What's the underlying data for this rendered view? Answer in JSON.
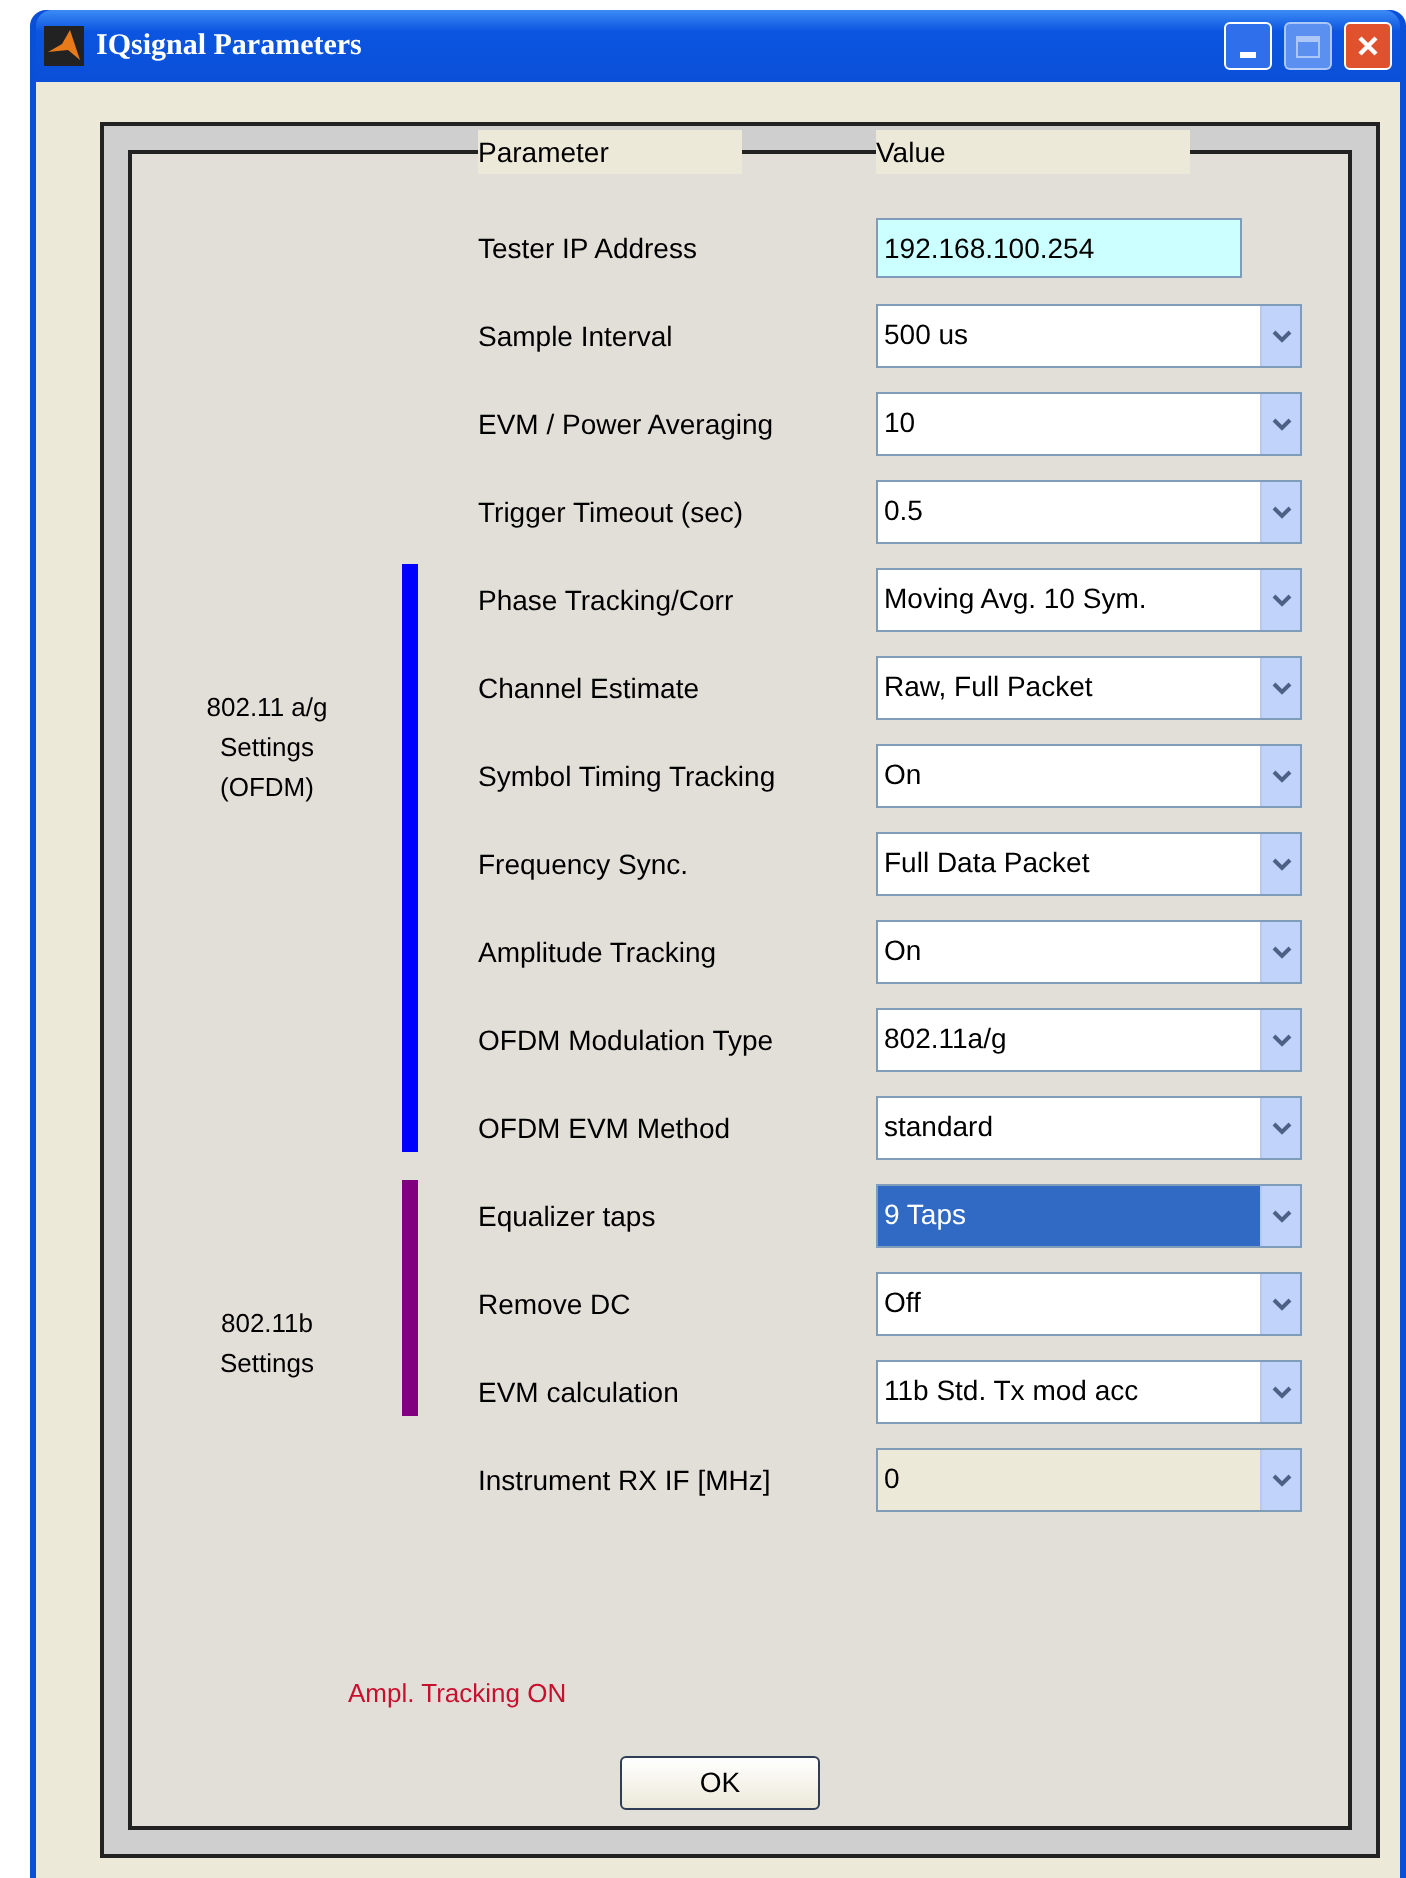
{
  "window": {
    "title": "IQsignal Parameters"
  },
  "headers": [
    "Parameter",
    "Value"
  ],
  "rows": [
    {
      "label": "Tester IP Address",
      "kind": "text",
      "value": "192.168.100.254",
      "focused": false,
      "disabled": false
    },
    {
      "label": "Sample Interval",
      "kind": "dropdown",
      "value": "500 us",
      "focused": false,
      "disabled": false
    },
    {
      "label": "EVM / Power Averaging",
      "kind": "dropdown",
      "value": "10",
      "focused": false,
      "disabled": false
    },
    {
      "label": "Trigger Timeout (sec)",
      "kind": "dropdown",
      "value": "0.5",
      "focused": false,
      "disabled": false
    }
  ],
  "groups": [
    {
      "title": "802.11 a/g Settings (OFDM)",
      "color": "#0000ff",
      "rows": [
        {
          "label": "Phase Tracking/Corr",
          "kind": "dropdown",
          "value": "Moving Avg. 10 Sym.",
          "focused": false,
          "disabled": false
        },
        {
          "label": "Channel Estimate",
          "kind": "dropdown",
          "value": "Raw, Full Packet",
          "focused": false,
          "disabled": false
        },
        {
          "label": "Symbol Timing Tracking",
          "kind": "dropdown",
          "value": "On",
          "focused": false,
          "disabled": false
        },
        {
          "label": "Frequency Sync.",
          "kind": "dropdown",
          "value": "Full Data Packet",
          "focused": false,
          "disabled": false
        },
        {
          "label": "Amplitude Tracking",
          "kind": "dropdown",
          "value": "On",
          "focused": false,
          "disabled": false
        },
        {
          "label": "OFDM Modulation Type",
          "kind": "dropdown",
          "value": "802.11a/g",
          "focused": false,
          "disabled": false
        },
        {
          "label": "OFDM EVM Method",
          "kind": "dropdown",
          "value": "standard",
          "focused": false,
          "disabled": false
        }
      ]
    },
    {
      "title": "802.11b Settings",
      "color": "#800080",
      "rows": [
        {
          "label": "Equalizer taps",
          "kind": "dropdown",
          "value": "9 Taps",
          "focused": true,
          "disabled": false
        },
        {
          "label": "Remove DC",
          "kind": "dropdown",
          "value": "Off",
          "focused": false,
          "disabled": false
        },
        {
          "label": "EVM calculation",
          "kind": "dropdown",
          "value": "11b Std. Tx mod acc",
          "focused": false,
          "disabled": false
        }
      ]
    }
  ],
  "trailing_rows": [
    {
      "label": "Instrument RX IF [MHz]",
      "kind": "dropdown",
      "value": "0",
      "focused": false,
      "disabled": true
    }
  ],
  "status": "Ampl. Tracking ON",
  "ok_button": "OK"
}
